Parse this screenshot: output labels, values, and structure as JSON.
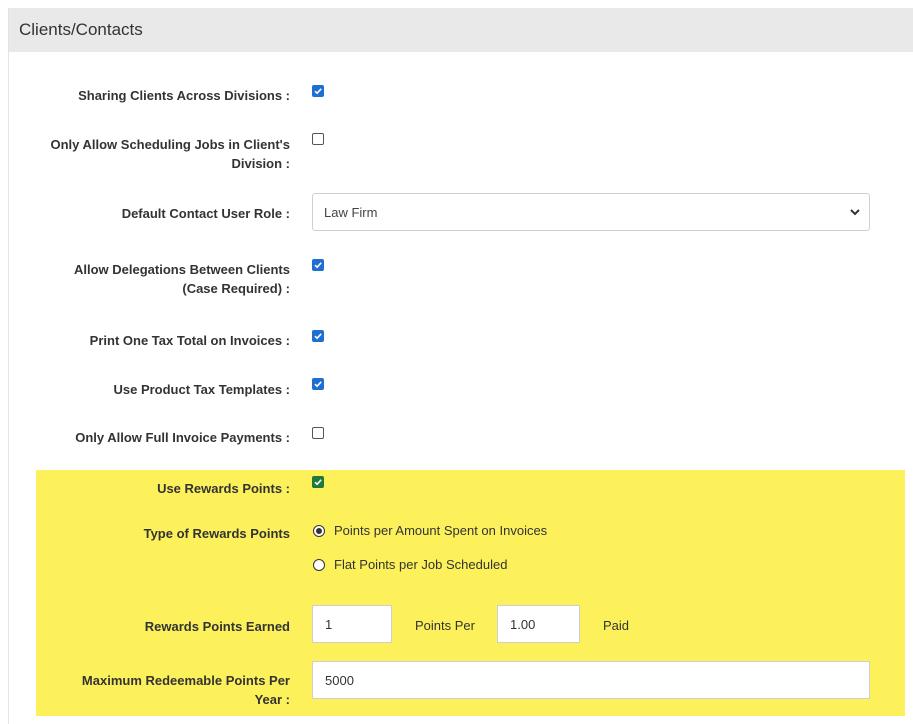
{
  "panel": {
    "title": "Clients/Contacts"
  },
  "settings": {
    "sharing_clients": {
      "label": "Sharing Clients Across Divisions :",
      "checked": true
    },
    "only_scheduling": {
      "label_line1": "Only Allow Scheduling Jobs in Client's",
      "label_line2": "Division :",
      "checked": false
    },
    "default_role": {
      "label": "Default Contact User Role :",
      "value": "Law Firm"
    },
    "delegations": {
      "label_line1": "Allow Delegations Between Clients",
      "label_line2": "(Case Required) :",
      "checked": true
    },
    "one_tax_total": {
      "label": "Print One Tax Total on Invoices :",
      "checked": true
    },
    "product_tax": {
      "label": "Use Product Tax Templates :",
      "checked": true
    },
    "full_payments": {
      "label": "Only Allow Full Invoice Payments :",
      "checked": false
    },
    "use_rewards": {
      "label": "Use Rewards Points :",
      "checked": true
    },
    "rewards_type": {
      "label": "Type of Rewards Points",
      "options": [
        "Points per Amount Spent on Invoices",
        "Flat Points per Job Scheduled"
      ],
      "selected": "Points per Amount Spent on Invoices"
    },
    "rewards_earned": {
      "label": "Rewards Points Earned",
      "points": "1",
      "points_per_label": "Points Per",
      "amount": "1.00",
      "paid_label": "Paid"
    },
    "max_redeemable": {
      "label_line1": "Maximum Redeemable Points Per",
      "label_line2": "Year :",
      "value": "5000"
    }
  },
  "colors": {
    "highlight": "#fcf15b",
    "checkbox": "#1e6fd1",
    "header_bg": "#e9e9e9"
  }
}
